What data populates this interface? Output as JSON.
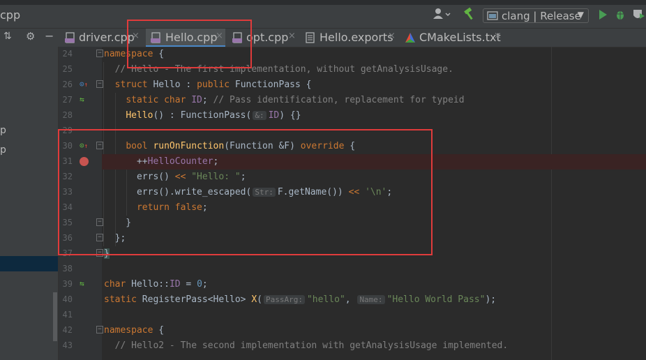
{
  "window": {
    "breadcrumb": "cpp"
  },
  "toolbar": {
    "run_config": "clang | Release"
  },
  "tabs": [
    {
      "label": "driver.cpp",
      "active": false
    },
    {
      "label": "Hello.cpp",
      "active": true
    },
    {
      "label": "opt.cpp",
      "active": false
    },
    {
      "label": "Hello.exports",
      "active": false
    },
    {
      "label": "CMakeLists.txt",
      "active": false
    }
  ],
  "tab_close_glyph": "×",
  "editor": {
    "lines": [
      {
        "n": "24",
        "text": "namespace {"
      },
      {
        "n": "25",
        "text": "  // Hello - The first implementation, without getAnalysisUsage."
      },
      {
        "n": "26",
        "text": "  struct Hello : public FunctionPass {"
      },
      {
        "n": "27",
        "text": "    static char ID; // Pass identification, replacement for typeid"
      },
      {
        "n": "28",
        "text": "    Hello() : FunctionPass( &: ID) {}"
      },
      {
        "n": "29",
        "text": ""
      },
      {
        "n": "30",
        "text": "    bool runOnFunction(Function &F) override {"
      },
      {
        "n": "31",
        "text": "      ++HelloCounter;"
      },
      {
        "n": "32",
        "text": "      errs() << \"Hello: \";"
      },
      {
        "n": "33",
        "text": "      errs().write_escaped( Str: F.getName()) << '\\n';"
      },
      {
        "n": "34",
        "text": "      return false;"
      },
      {
        "n": "35",
        "text": "    }"
      },
      {
        "n": "36",
        "text": "  };"
      },
      {
        "n": "37",
        "text": "}"
      },
      {
        "n": "38",
        "text": ""
      },
      {
        "n": "39",
        "text": "char Hello::ID = 0;"
      },
      {
        "n": "40",
        "text": "static RegisterPass<Hello> X( PassArg: \"hello\",  Name: \"Hello World Pass\");"
      },
      {
        "n": "41",
        "text": ""
      },
      {
        "n": "42",
        "text": "namespace {"
      },
      {
        "n": "43",
        "text": "  // Hello2 - The second implementation with getAnalysisUsage implemented."
      }
    ],
    "hints": {
      "ref": "&:",
      "str": "Str:",
      "passarg": "PassArg:",
      "name": "Name:"
    }
  },
  "colors": {
    "annotation": "#e03b3b",
    "breakpoint": "#c75450",
    "active_tab_underline": "#4a88c7"
  }
}
